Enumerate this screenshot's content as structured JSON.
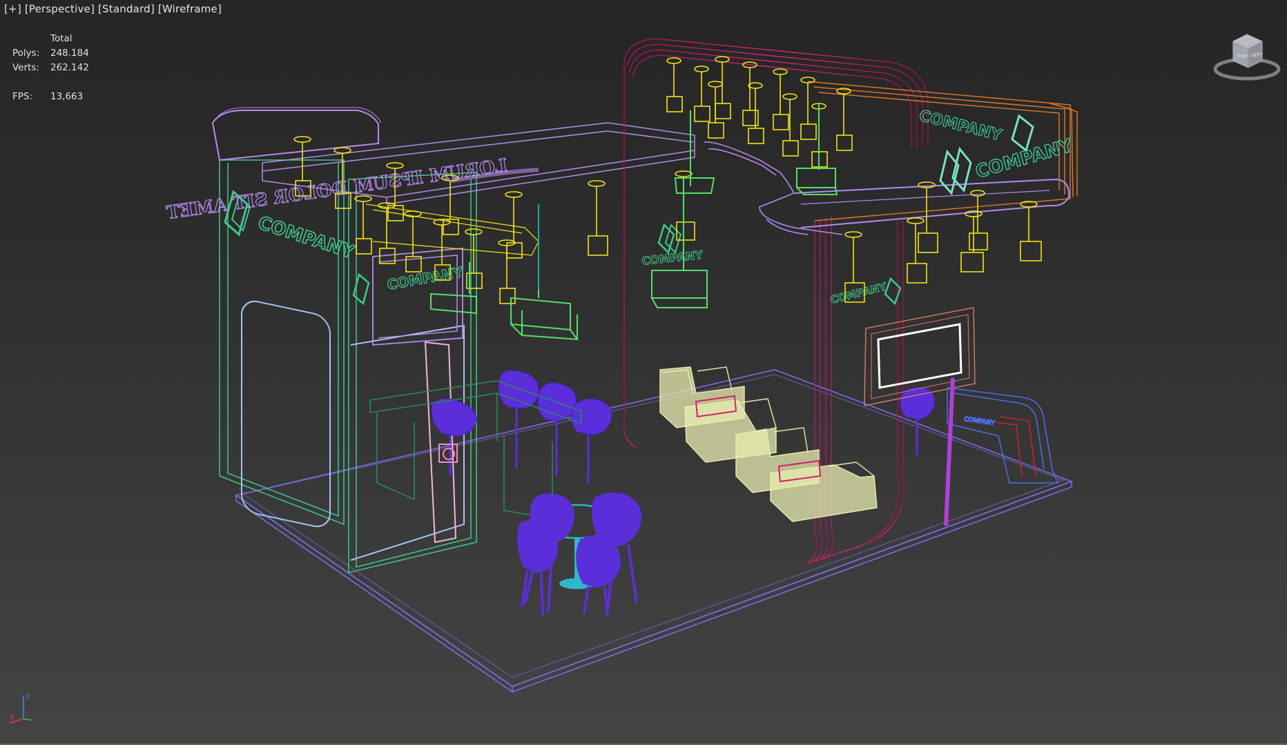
{
  "viewport": {
    "label_plus": "[+]",
    "label_view": "[Perspective]",
    "label_shading": "[Standard]",
    "label_mode": "[Wireframe]"
  },
  "stats": {
    "header": "Total",
    "polys_label": "Polys:",
    "polys_value": "248.184",
    "verts_label": "Verts:",
    "verts_value": "262.142",
    "fps_label": "FPS:",
    "fps_value": "13,663"
  },
  "scene": {
    "header_banner_text": "LORUM IPSUM DOLOR SIT AMET",
    "company_text": "COMPANY",
    "colors": {
      "floor": "#7a6de0",
      "left_wall": "#3ec98a",
      "arch": "#d0206a",
      "lights": "#f2e418",
      "hanging_boxes": "#55e06a",
      "chairs": "#5a2ed8",
      "sofas": "#e8edb0",
      "canopy": "#b68cf0",
      "side_canopy": "#e07a2a",
      "counter": "#4a6ee8",
      "tv": "#ffffff"
    }
  },
  "viewcube": {
    "icon": "viewcube-icon",
    "face_top": "TOP",
    "face_left": "LEFT"
  },
  "axis": {
    "z": "z",
    "x": "x"
  }
}
